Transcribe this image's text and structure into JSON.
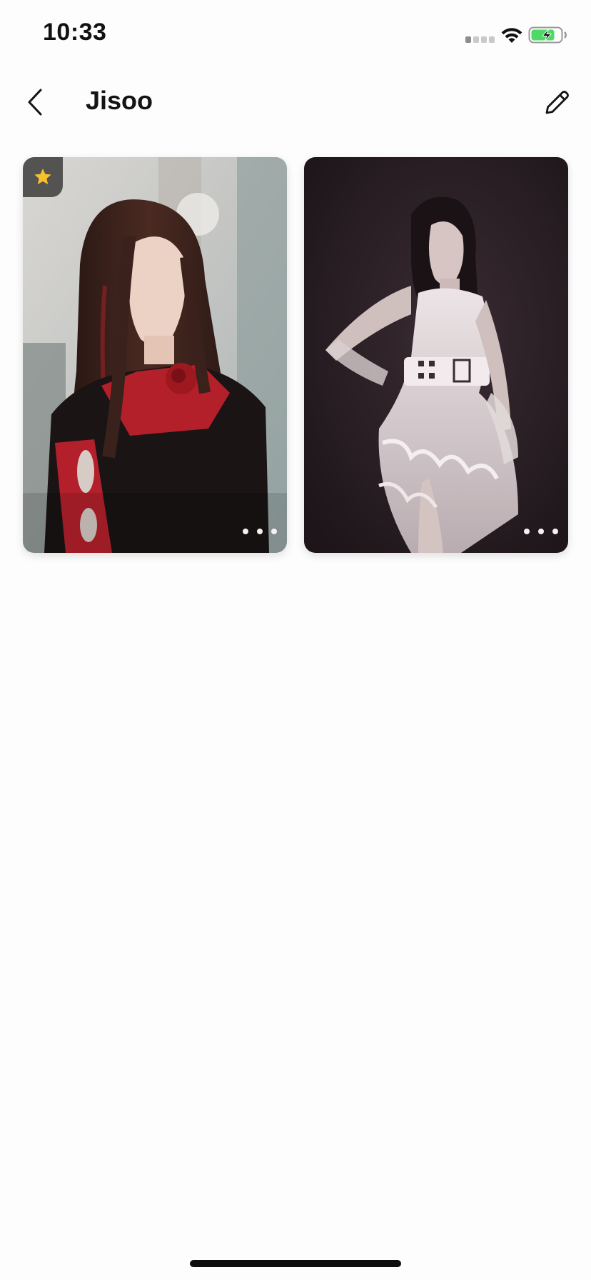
{
  "status_bar": {
    "time": "10:33",
    "signal_bars_active": 1,
    "battery_level": 0.75,
    "battery_charging": true,
    "battery_color": "#4cd964"
  },
  "nav": {
    "title": "Jisoo",
    "back_icon": "chevron-left-icon",
    "edit_icon": "pencil-icon"
  },
  "photos": [
    {
      "favorite": true,
      "favorite_color": "#f6c12b",
      "more_icon": "ellipsis-icon"
    },
    {
      "favorite": false,
      "more_icon": "ellipsis-icon"
    }
  ],
  "colors": {
    "background": "#fdfdfd",
    "text": "#141414"
  }
}
